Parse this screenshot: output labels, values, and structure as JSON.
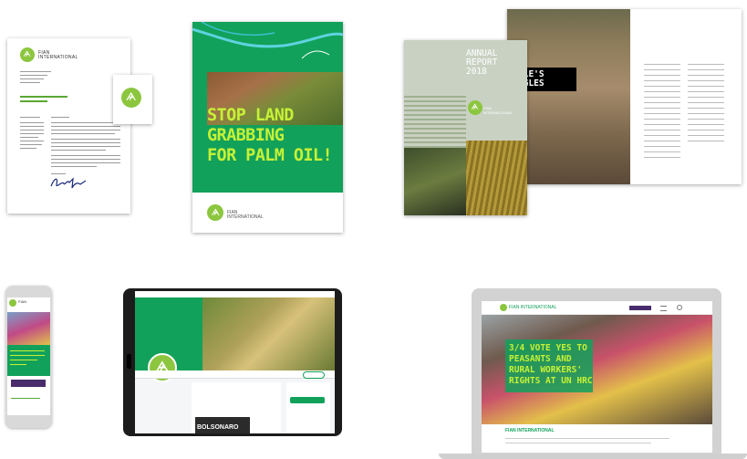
{
  "colors": {
    "brand_green": "#12a15a",
    "logo_lime": "#8cc63f",
    "headline_lime": "#c5f136",
    "report_bg": "#c9d1c2",
    "purple_button": "#4a2c6d"
  },
  "icons": [
    "fian-logo-icon",
    "menu-icon",
    "search-icon"
  ],
  "letterhead": {
    "brand_line1": "FIAN",
    "brand_line2": "INTERNATIONAL"
  },
  "booklet": {
    "headline_lines": [
      "STOP LAND",
      "GRABBING",
      "FOR PALM OIL!"
    ],
    "brand_line1": "FIAN",
    "brand_line2": "INTERNATIONAL"
  },
  "annual_report": {
    "title_lines": [
      "ANNUAL",
      "REPORT",
      "2018"
    ],
    "brand_line1": "FIAN",
    "brand_line2": "INTERNATIONAL",
    "spread_heading_lines": [
      "PLE'S",
      "GGLES"
    ]
  },
  "phone": {
    "brand": "FIAN"
  },
  "laptop": {
    "brand": "FIAN INTERNATIONAL",
    "hero_lines": [
      "3/4 VOTE YES TO",
      "PEASANTS AND",
      "RURAL WORKERS'",
      "RIGHTS AT UN HRC"
    ],
    "section_title": "FIAN INTERNATIONAL"
  },
  "tablet": {
    "post_text": "BOLSONARO"
  }
}
